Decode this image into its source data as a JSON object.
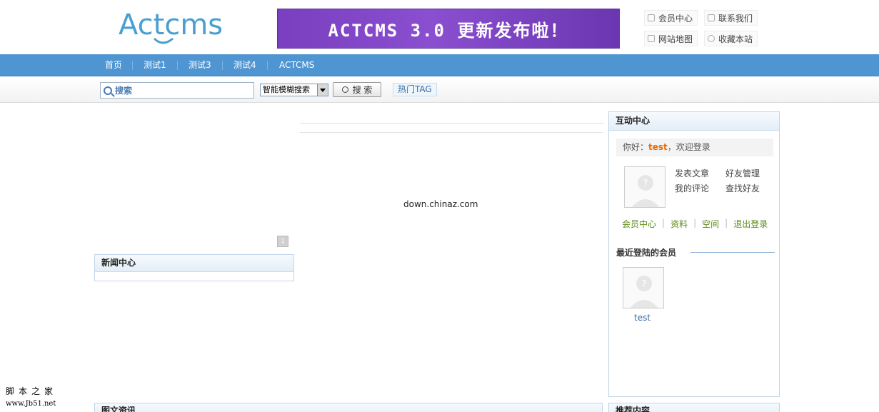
{
  "header": {
    "logo_text": "Actcms",
    "banner_text": "ACTCMS 3.0 更新发布啦！",
    "top_links": [
      {
        "label": "会员中心",
        "icon": "user-icon"
      },
      {
        "label": "联系我们",
        "icon": "chat-icon"
      },
      {
        "label": "网站地图",
        "icon": "map-icon"
      },
      {
        "label": "收藏本站",
        "icon": "favorite-icon"
      }
    ]
  },
  "nav": {
    "items": [
      "首页",
      "测试1",
      "测试3",
      "测试4",
      "ACTCMS"
    ]
  },
  "search": {
    "placeholder": "搜索",
    "mode_selected": "智能模糊搜索",
    "button_label": "搜 索",
    "hot_tag_label": "热门TAG"
  },
  "main": {
    "center_text": "down.chinaz.com",
    "news_title": "新闻中心",
    "bottom_left_title": "图文资讯",
    "bottom_right_title": "推荐内容"
  },
  "sidebar": {
    "title": "互动中心",
    "greeting_prefix": "你好：",
    "username": "test",
    "greeting_suffix": "，欢迎登录",
    "quick_links": [
      "发表文章",
      "好友管理",
      "我的评论",
      "查找好友"
    ],
    "member_links": [
      "会员中心",
      "资料",
      "空间",
      "退出登录"
    ],
    "recent_title": "最近登陆的会员",
    "recent_members": [
      "test"
    ]
  },
  "watermark": {
    "line1": "脚本之家",
    "line2": "www.Jb51.net"
  },
  "colors": {
    "nav_bg": "#4f95d2",
    "banner": "#7a3fbf",
    "username": "#e56a00",
    "member_link": "#5c8a16"
  }
}
